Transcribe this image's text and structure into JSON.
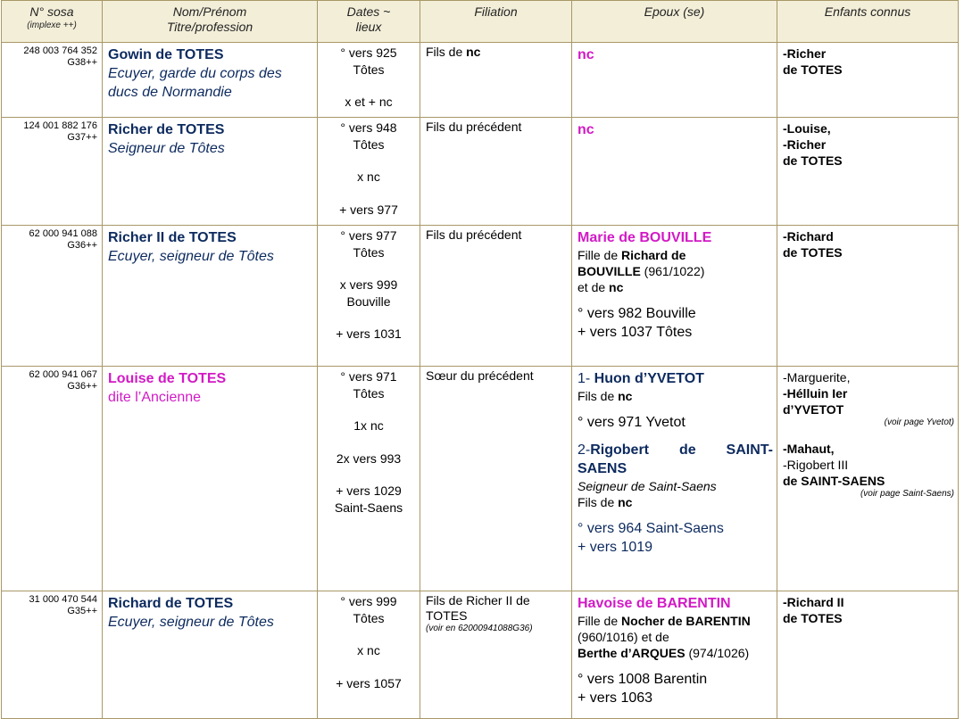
{
  "headers": {
    "sosa": "N° sosa",
    "sosa_sub": "(implexe ++)",
    "name": "Nom/Prénom",
    "name_sub": "Titre/profession",
    "dates": "Dates ~",
    "dates_sub": "lieux",
    "filiation": "Filiation",
    "spouse": "Epoux (se)",
    "children": "Enfants connus"
  },
  "rows": [
    {
      "sosa": "248 003 764 352",
      "gen": "G38++",
      "name": "Gowin de TOTES",
      "title": "Ecuyer, garde du corps des ducs de Normandie",
      "dates": [
        "° vers 925",
        "Tôtes",
        "",
        "x et + nc"
      ],
      "filiation_pre": "Fils de ",
      "filiation_bold": "nc",
      "spouse": "nc",
      "children": [
        "-Richer",
        "de TOTES"
      ]
    },
    {
      "sosa": "124 001 882 176",
      "gen": "G37++",
      "name": "Richer de TOTES",
      "title": "Seigneur de Tôtes",
      "dates": [
        "° vers 948",
        "Tôtes",
        "",
        "x nc",
        "",
        "+ vers 977"
      ],
      "filiation": "Fils du précédent",
      "spouse": "nc",
      "children": [
        "-Louise,",
        "-Richer",
        "de TOTES"
      ]
    },
    {
      "sosa": "62 000 941 088",
      "gen": "G36++",
      "name": "Richer II de TOTES",
      "title": "Ecuyer, seigneur de Tôtes",
      "dates": [
        "° vers 977",
        "Tôtes",
        "",
        "x vers 999",
        "Bouville",
        "",
        "+ vers 1031"
      ],
      "filiation": "Fils du précédent",
      "spouse_name": "Marie de BOUVILLE",
      "spouse_p1": "Fille de ",
      "spouse_f1": "Richard de",
      "spouse_f2": "BOUVILLE",
      "spouse_f2_years": " (961/1022)",
      "spouse_p2": "et de ",
      "spouse_m": "nc",
      "spouse_birth": "° vers 982 Bouville",
      "spouse_death": "+ vers 1037 Tôtes",
      "children": [
        "-Richard",
        "de TOTES"
      ]
    },
    {
      "sosa": "62 000 941 067",
      "gen": "G36++",
      "name": "Louise de TOTES",
      "title": "dite l’Ancienne",
      "dates": [
        "° vers 971",
        "Tôtes",
        "",
        "1x nc",
        "",
        "2x vers 993",
        "",
        "+ vers 1029",
        "Saint-Saens"
      ],
      "filiation": "Sœur du précédent",
      "sp1_prefix": "1- ",
      "sp1_name": "Huon d’YVETOT",
      "sp1_p": "Fils de ",
      "sp1_f": "nc",
      "sp1_birth": "° vers 971 Yvetot",
      "sp2_prefix": "2-",
      "sp2_name_w1": "Rigobert",
      "sp2_name_w2": "de",
      "sp2_name_w3": "SAINT-",
      "sp2_name_l2": "SAENS",
      "sp2_title": "Seigneur de Saint-Saens",
      "sp2_p": "Fils de ",
      "sp2_f": "nc",
      "sp2_birth": "° vers 964 Saint-Saens",
      "sp2_death": "+ vers 1019",
      "ch_a1": "-Marguerite,",
      "ch_a2": "-Hélluin Ier",
      "ch_a3": "d’YVETOT",
      "ch_a_note": "(voir page Yvetot)",
      "ch_b1": "-Mahaut,",
      "ch_b2": "-Rigobert III",
      "ch_b3": "de SAINT-SAENS",
      "ch_b_note": "(voir page Saint-Saens)"
    },
    {
      "sosa": "31 000 470 544",
      "gen": "G35++",
      "name": "Richard de TOTES",
      "title": "Ecuyer, seigneur de Tôtes",
      "dates": [
        "° vers 999",
        "Tôtes",
        "",
        "x nc",
        "",
        "+ vers 1057"
      ],
      "filiation_l1": "Fils de Richer II de",
      "filiation_l2": "TOTES",
      "filiation_note": "(voir en 62000941088G36)",
      "spouse_name": "Havoise de BARENTIN",
      "spouse_p1": "Fille de ",
      "spouse_f": "Nocher de BARENTIN",
      "spouse_f_years": "(960/1016) et de",
      "spouse_m": "Berthe d’ARQUES",
      "spouse_m_years": " (974/1026)",
      "spouse_birth": "° vers 1008 Barentin",
      "spouse_death": "+ vers 1063",
      "children": [
        "-Richard II",
        "de TOTES"
      ]
    }
  ]
}
